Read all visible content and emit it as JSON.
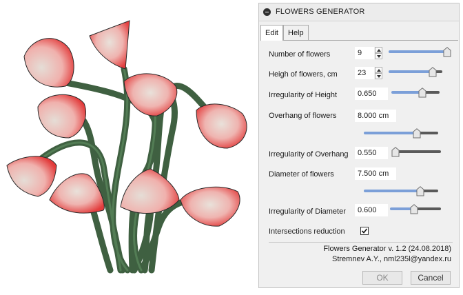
{
  "panel": {
    "title": "FLOWERS GENERATOR",
    "tabs": [
      {
        "label": "Edit",
        "active": true
      },
      {
        "label": "Help",
        "active": false
      }
    ],
    "params": {
      "number_of_flowers": {
        "label": "Number of flowers",
        "value": "9",
        "slider": 0.97
      },
      "height_of_flowers": {
        "label": "Heigh of flowers, cm",
        "value": "23",
        "slider": 0.82
      },
      "irregularity_height": {
        "label": "Irregularity of Height",
        "value": "0.650",
        "slider": 0.64
      },
      "overhang": {
        "label": "Overhang of flowers",
        "value": "8.000 cm",
        "slider": 0.71
      },
      "irregularity_overhang": {
        "label": "Irregularity of Overhang",
        "value": "0.550",
        "slider": 0.05
      },
      "diameter": {
        "label": "Diameter of flowers",
        "value": "7.500 cm",
        "slider": 0.76
      },
      "irregularity_diameter": {
        "label": "Irregularity of Diameter",
        "value": "0.600",
        "slider": 0.47
      },
      "intersections": {
        "label": "Intersections reduction",
        "checked": true
      }
    },
    "credit_line1": "Flowers Generator v. 1.2 (24.08.2018)",
    "credit_line2": "Stremnev A.Y., nml235l@yandex.ru",
    "ok_label": "OK",
    "cancel_label": "Cancel"
  },
  "colors": {
    "accent": "#7b9fd8",
    "stem": "#3f6041",
    "petal": "#e84a4a"
  }
}
